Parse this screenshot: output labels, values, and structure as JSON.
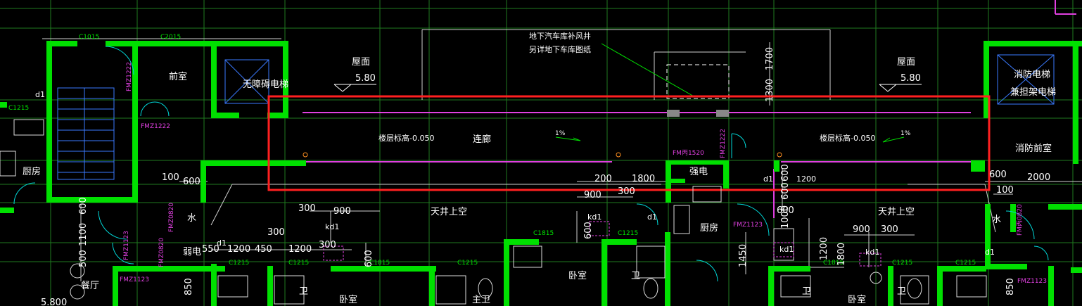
{
  "colors": {
    "background": "#000000",
    "wall": "#00e000",
    "grid": "#1f7a1f",
    "text": "#ffffff",
    "door": "#00d8d8",
    "magenta": "#e040e0",
    "highlight": "#ff2020",
    "dim_tick": "#00ff00"
  },
  "labels": {
    "garage_vent_1": "地下汽车库补风井",
    "garage_vent_2": "另详地下车库图纸",
    "roof_left": "屋面",
    "roof_left_elev": "5.80",
    "roof_right": "屋面",
    "roof_right_elev": "5.80",
    "dim_1700": "1700",
    "dim_1300": "1300",
    "vestibule": "前室",
    "accessible_elevator": "无障碍电梯",
    "fire_elevator_1": "消防电梯",
    "fire_elevator_2": "兼担架电梯",
    "fire_vestibule": "消防前室",
    "floor_level_left": "楼层标高-0.050",
    "floor_level_right": "楼层标高-0.050",
    "corridor": "连廊",
    "slope_left": "1%",
    "slope_right": "1%",
    "electric_room": "强电",
    "atrium_left": "天井上空",
    "atrium_right": "天井上空",
    "kitchen_left": "厨房",
    "kitchen_center": "厨房",
    "water_left": "水",
    "water_right": "水",
    "electric_left": "弱电",
    "dining": "餐厅",
    "bedroom_1": "卧室",
    "bedroom_2": "卧室",
    "bedroom_3": "卧室",
    "master_bath": "主卫",
    "bath_1": "卫",
    "bath_2": "卫",
    "bath_3": "卫",
    "bath_4": "卫",
    "window_c1015": "C1015",
    "window_c2015": "C2015",
    "window_c1215_a": "C1215",
    "window_c1215_b": "C1215",
    "window_c1215_c": "C1215",
    "window_c1215_d": "C1215",
    "window_c1215_e": "C1215",
    "window_c1215_f": "C1215",
    "window_c1215_g": "C1215",
    "window_c1815": "C1815",
    "window_c1815_b": "C1815",
    "door_fmz1222_a": "FMZ1222",
    "door_fmz1222_b": "FMZ1222",
    "door_fmz1222_c": "FMZ1222",
    "door_fmz1123_a": "FMZ1123",
    "door_fmz1123_b": "FMZ1123",
    "door_fmz1123_c": "FMZ1123",
    "door_fmz1123_d": "FMZ1123",
    "door_fmz0820": "FMZ0820",
    "door_fmz0820_b": "FMZ0820",
    "door_fmz1520": "FM丙1520",
    "door_fmz0820_c": "FM丙0820",
    "kd1_a": "kd1",
    "kd1_b": "kd1",
    "kd1_c": "kd1",
    "kd1_d": "kd1",
    "d1_a": "d1",
    "d1_b": "d1",
    "d1_c": "d1",
    "d1_d": "d1",
    "d1_e": "d1",
    "dim_100_a": "100",
    "dim_600_a": "600",
    "dim_300_a": "300",
    "dim_900_a": "900",
    "dim_300_b": "300",
    "dim_550": "550",
    "dim_1200_a": "1200",
    "dim_450": "450",
    "dim_1200_b": "1200",
    "dim_300_c": "300",
    "dim_600_b": "600",
    "dim_1100": "1100",
    "dim_500": "500",
    "dim_850_a": "850",
    "dim_200": "200",
    "dim_1800": "1800",
    "dim_900_b": "900",
    "dim_300_d": "300",
    "dim_600_c": "600",
    "dim_600_d": "600",
    "dim_600_e": "600",
    "dim_1000": "1000",
    "dim_1200_c": "1200",
    "dim_1450": "1450",
    "dim_600_f": "600",
    "dim_900_c": "900",
    "dim_300_e": "300",
    "dim_1200_d": "1200",
    "dim_1800_b": "1800",
    "dim_600_g": "600",
    "dim_2000": "2000",
    "dim_100_b": "100",
    "dim_850_b": "850",
    "dim_5800": "5.800",
    "dim_600_h": "600",
    "dim_600_i": "600",
    "dim_600_j": "600"
  }
}
